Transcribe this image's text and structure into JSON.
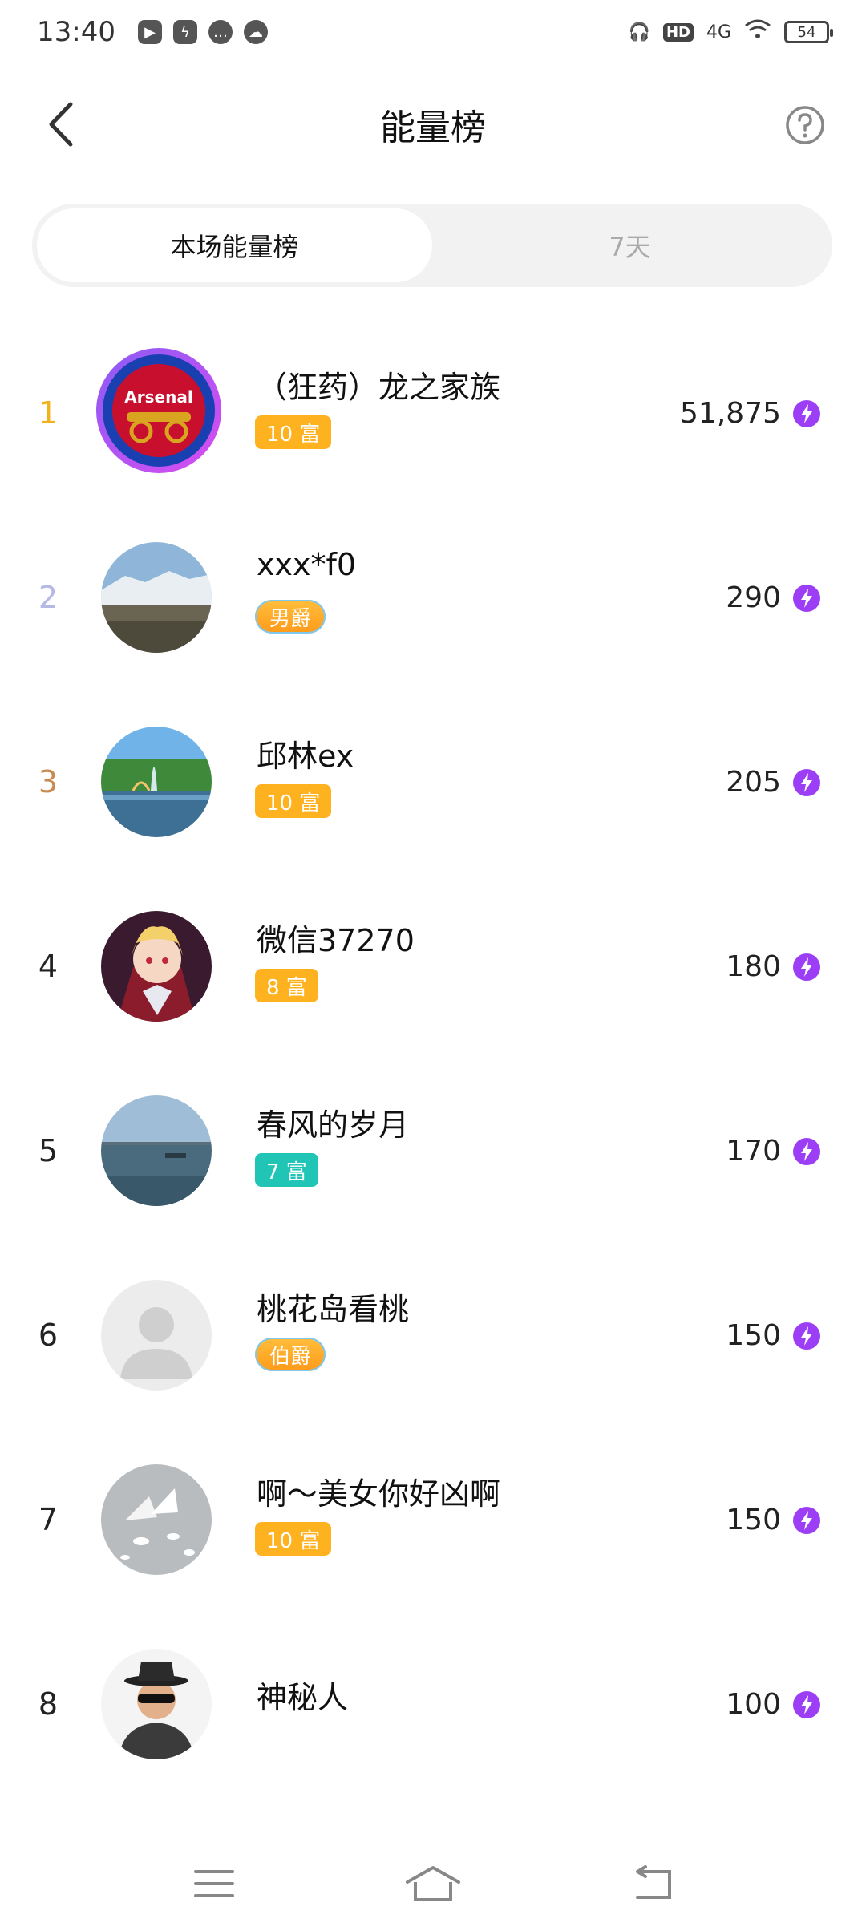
{
  "status_bar": {
    "time": "13:40",
    "hd": "HD",
    "network": "4G",
    "battery": "54"
  },
  "header": {
    "title": "能量榜"
  },
  "tabs": [
    {
      "label": "本场能量榜",
      "active": true
    },
    {
      "label": "7天",
      "active": false
    }
  ],
  "entries": [
    {
      "rank": "1",
      "rank_color": "#f2b21c",
      "name": "（狂药）龙之家族",
      "badge": "10 富",
      "badge_type": "wealth",
      "badge_color": "#ffb21f",
      "score": "51,875",
      "avatar": "arsenal-avatar"
    },
    {
      "rank": "2",
      "rank_color": "#b5b9e6",
      "name": "xxx*f0",
      "badge": "男爵",
      "badge_type": "noble",
      "badge_color": "#ffab2a",
      "score": "290",
      "avatar": "mountain-avatar"
    },
    {
      "rank": "3",
      "rank_color": "#c98a52",
      "name": "邱林ex",
      "badge": "10 富",
      "badge_type": "wealth",
      "badge_color": "#ffb21f",
      "score": "205",
      "avatar": "fountain-avatar"
    },
    {
      "rank": "4",
      "rank_color": "#222222",
      "name": "微信37270",
      "badge": "8 富",
      "badge_type": "wealth",
      "badge_color": "#ffb21f",
      "score": "180",
      "avatar": "anime-avatar"
    },
    {
      "rank": "5",
      "rank_color": "#222222",
      "name": "春风的岁月",
      "badge": "7 富",
      "badge_type": "wealth",
      "badge_color": "#20c5b5",
      "score": "170",
      "avatar": "lake-avatar"
    },
    {
      "rank": "6",
      "rank_color": "#222222",
      "name": "桃花岛看桃",
      "badge": "伯爵",
      "badge_type": "noble",
      "badge_color": "#ffab2a",
      "score": "150",
      "avatar": "default-avatar"
    },
    {
      "rank": "7",
      "rank_color": "#222222",
      "name": "啊～美女你好凶啊",
      "badge": "10 富",
      "badge_type": "wealth",
      "badge_color": "#ffb21f",
      "score": "150",
      "avatar": "seagull-avatar"
    },
    {
      "rank": "8",
      "rank_color": "#222222",
      "name": "神秘人",
      "badge": "",
      "badge_type": "none",
      "badge_color": "",
      "score": "100",
      "avatar": "mystery-avatar"
    }
  ],
  "icons": {
    "back": "chevron-left-icon",
    "help": "question-circle-icon",
    "energy": "lightning-bolt-icon",
    "menu": "menu-icon",
    "home": "home-icon",
    "return": "return-icon"
  }
}
